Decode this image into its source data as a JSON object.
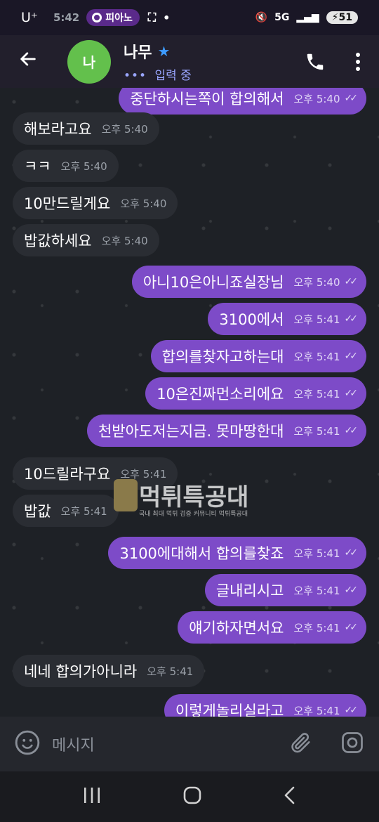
{
  "status": {
    "carrier": "U⁺",
    "time": "5:42",
    "app_pill": "피아노",
    "battery": "51"
  },
  "header": {
    "avatar_letter": "나",
    "contact_name": "나무",
    "typing": "입력 중"
  },
  "messages": [
    {
      "dir": "out",
      "text": "중단하시는쪽이 합의해서",
      "time": "오후 5:40"
    },
    {
      "dir": "in",
      "text": "해보라고요",
      "time": "오후 5:40"
    },
    {
      "dir": "in",
      "text": "ㅋㅋ",
      "time": "오후 5:40"
    },
    {
      "dir": "in",
      "text": "10만드릴게요",
      "time": "오후 5:40"
    },
    {
      "dir": "in",
      "text": "밥값하세요",
      "time": "오후 5:40"
    },
    {
      "dir": "out",
      "text": "아니10은아니죠실장님",
      "time": "오후 5:40"
    },
    {
      "dir": "out",
      "text": "3100에서",
      "time": "오후 5:41"
    },
    {
      "dir": "out",
      "text": "합의를찾자고하는대",
      "time": "오후 5:41"
    },
    {
      "dir": "out",
      "text": "10은진짜먼소리에요",
      "time": "오후 5:41"
    },
    {
      "dir": "out",
      "text": "천받아도저는지금. 못마땅한대",
      "time": "오후 5:41"
    },
    {
      "dir": "in",
      "text": "10드릴라구요",
      "time": "오후 5:41"
    },
    {
      "dir": "in",
      "text": "밥값",
      "time": "오후 5:41"
    },
    {
      "dir": "out",
      "text": "3100에대해서 합의를찾죠",
      "time": "오후 5:41"
    },
    {
      "dir": "out",
      "text": "글내리시고",
      "time": "오후 5:41"
    },
    {
      "dir": "out",
      "text": "얘기하자면서요",
      "time": "오후 5:41"
    },
    {
      "dir": "in",
      "text": "네네 합의가아니라",
      "time": "오후 5:41"
    },
    {
      "dir": "out",
      "text": "이렇게놀리실라고",
      "time": "오후 5:41"
    }
  ],
  "watermark": {
    "title": "먹튀특공대",
    "subtitle": "국내 최대 먹튀 검증 커뮤니티 먹튀특공대"
  },
  "composer": {
    "placeholder": "메시지"
  },
  "colors": {
    "outgoing_bubble": "#7d4bc8",
    "incoming_bubble": "#2a2d33",
    "avatar": "#63c04c"
  }
}
